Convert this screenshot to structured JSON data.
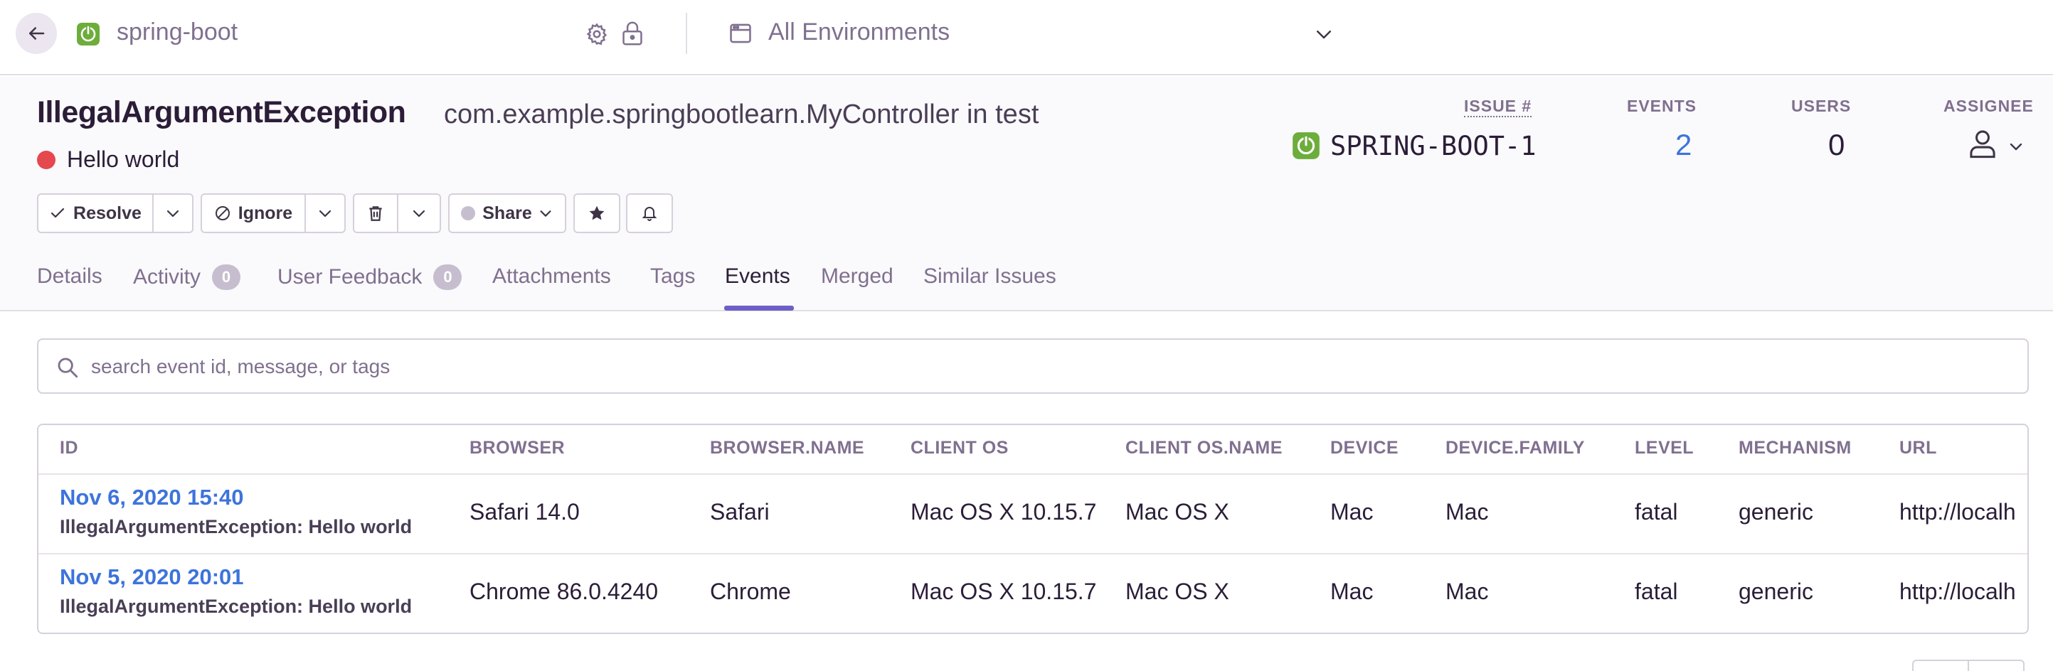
{
  "topbar": {
    "project_name": "spring-boot",
    "environment": "All Environments"
  },
  "issue": {
    "title": "IllegalArgumentException",
    "culprit": "com.example.springbootlearn.MyController in test",
    "message": "Hello world",
    "status_color": "#e5484d"
  },
  "stats": {
    "issue_label": "ISSUE #",
    "issue_value": "SPRING-BOOT-1",
    "events_label": "EVENTS",
    "events_value": "2",
    "users_label": "USERS",
    "users_value": "0",
    "assignee_label": "ASSIGNEE"
  },
  "actions": {
    "resolve": "Resolve",
    "ignore": "Ignore",
    "share": "Share"
  },
  "tabs": [
    {
      "label": "Details"
    },
    {
      "label": "Activity",
      "badge": "0"
    },
    {
      "label": "User Feedback",
      "badge": "0"
    },
    {
      "label": "Attachments"
    },
    {
      "label": "Tags"
    },
    {
      "label": "Events",
      "active": true
    },
    {
      "label": "Merged"
    },
    {
      "label": "Similar Issues"
    }
  ],
  "search": {
    "placeholder": "search event id, message, or tags"
  },
  "table": {
    "columns": [
      "ID",
      "BROWSER",
      "BROWSER.NAME",
      "CLIENT OS",
      "CLIENT OS.NAME",
      "DEVICE",
      "DEVICE.FAMILY",
      "LEVEL",
      "MECHANISM",
      "URL"
    ],
    "rows": [
      {
        "date": "Nov 6, 2020 15:40",
        "title": "IllegalArgumentException: Hello world",
        "browser": "Safari 14.0",
        "browser_name": "Safari",
        "client_os": "Mac OS X 10.15.7",
        "client_os_name": "Mac OS X",
        "device": "Mac",
        "device_family": "Mac",
        "level": "fatal",
        "mechanism": "generic",
        "url": "http://localh"
      },
      {
        "date": "Nov 5, 2020 20:01",
        "title": "IllegalArgumentException: Hello world",
        "browser": "Chrome 86.0.4240",
        "browser_name": "Chrome",
        "client_os": "Mac OS X 10.15.7",
        "client_os_name": "Mac OS X",
        "device": "Mac",
        "device_family": "Mac",
        "level": "fatal",
        "mechanism": "generic",
        "url": "http://localh"
      }
    ]
  },
  "colors": {
    "accent": "#6c5fc7",
    "link": "#3d74db",
    "project_green": "#6cad3b"
  }
}
